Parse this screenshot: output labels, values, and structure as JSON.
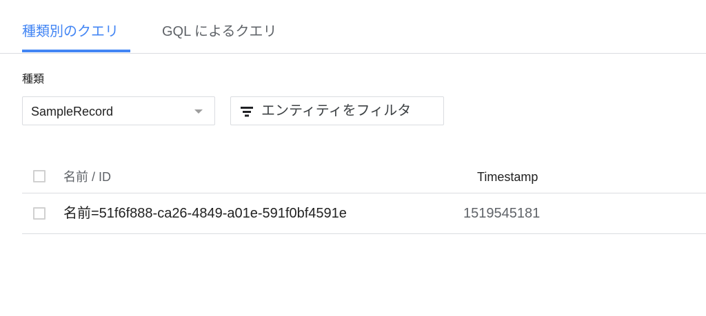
{
  "tabs": [
    {
      "label": "種類別のクエリ",
      "active": true
    },
    {
      "label": "GQL によるクエリ",
      "active": false
    }
  ],
  "kind": {
    "label": "種類",
    "selected": "SampleRecord"
  },
  "filter": {
    "icon": "filter-icon",
    "label": "エンティティをフィルタ"
  },
  "table": {
    "columns": [
      "名前 / ID",
      "Timestamp"
    ],
    "rows": [
      {
        "name": "名前=51f6f888-ca26-4849-a01e-591f0bf4591e",
        "timestamp": "1519545181"
      }
    ]
  },
  "colors": {
    "accent": "#4285f4",
    "border": "#dadce0",
    "text_primary": "#212121",
    "text_secondary": "#5f6368"
  }
}
